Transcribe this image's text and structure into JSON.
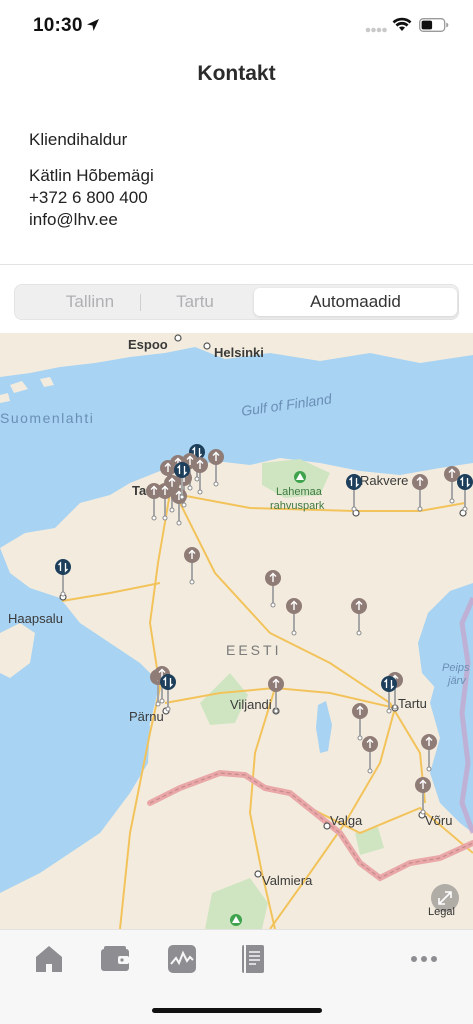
{
  "status_bar": {
    "time": "10:30",
    "location_icon": "location-arrow-icon",
    "signal_icon": "cellular-signal-icon",
    "wifi_icon": "wifi-icon",
    "battery_icon": "battery-icon"
  },
  "header": {
    "title": "Kontakt"
  },
  "contact": {
    "heading": "Kliendihaldur",
    "name": "Kätlin Hõbemägi",
    "phone": "+372 6 800 400",
    "email": "info@lhv.ee"
  },
  "segments": {
    "items": [
      {
        "label": "Tallinn",
        "selected": false
      },
      {
        "label": "Tartu",
        "selected": false
      },
      {
        "label": "Automaadid",
        "selected": true
      }
    ]
  },
  "map": {
    "labels": {
      "espoo": "Espoo",
      "helsinki": "Helsinki",
      "gulf": "Gulf of Finland",
      "suomenlahti": "Suomenlahti",
      "tallinn": "Ta",
      "lahemaa": "Lahemaa\nrahvuspark",
      "lahemaa_1": "Lahemaa",
      "lahemaa_2": "rahvuspark",
      "rakvere": "Rakvere",
      "haapsalu": "Haapsalu",
      "eesti": "EESTI",
      "parnu": "Pärnu",
      "viljandi": "Viljandi",
      "tartu": "Tartu",
      "peipsi_1": "Peips",
      "peipsi_2": "järv",
      "voru": "Võru",
      "valga": "Valga",
      "valmiera": "Valmiera",
      "legal": "Legal"
    },
    "colors": {
      "water": "#a8d3f2",
      "land": "#f3ecde",
      "forest": "#cfe5c1",
      "road": "#f3c35b",
      "border": "#e9a7a8",
      "pin_gray": "#8f7c77",
      "pin_dark": "#1e3f5c"
    },
    "expand_icon": "expand-arrows-icon"
  },
  "tab_bar": {
    "items": [
      {
        "name": "home",
        "icon": "home-icon"
      },
      {
        "name": "wallet",
        "icon": "wallet-icon"
      },
      {
        "name": "investments",
        "icon": "chart-icon"
      },
      {
        "name": "documents",
        "icon": "document-icon"
      },
      {
        "name": "more",
        "icon": "more-icon"
      }
    ]
  }
}
